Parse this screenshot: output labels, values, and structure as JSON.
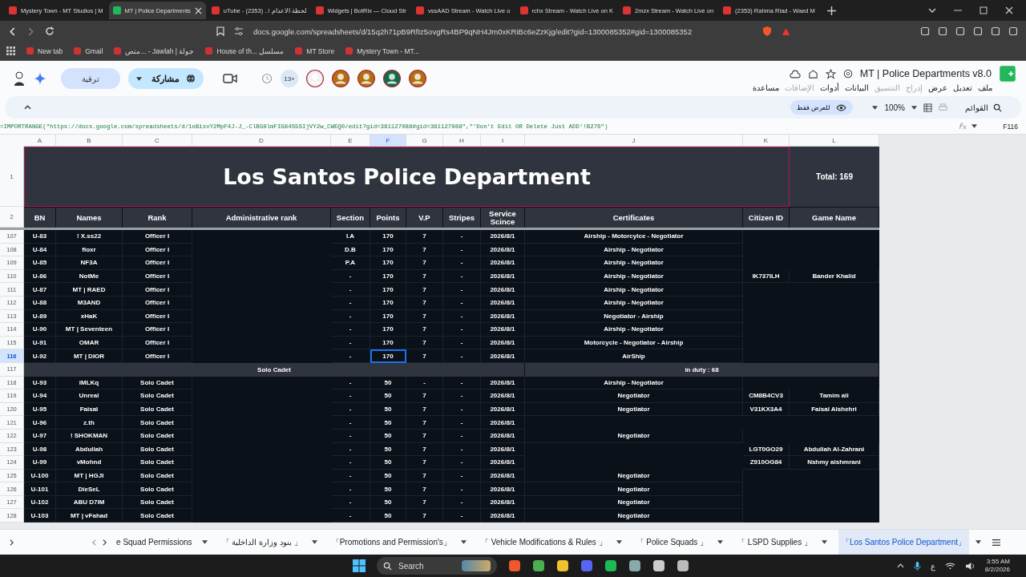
{
  "browser": {
    "tabs": [
      {
        "title": "Mystery Town - MT Studios | M",
        "selected": false
      },
      {
        "title": "MT | Police Departments",
        "selected": true
      },
      {
        "title": "uTube - لحظة الاعدام !.. (2353)",
        "selected": false
      },
      {
        "title": "Widgets | BotRix — Cloud Str",
        "selected": false
      },
      {
        "title": "vssAAD Stream - Watch Live o",
        "selected": false
      },
      {
        "title": "rchx Stream - Watch Live on K",
        "selected": false
      },
      {
        "title": "2mzx Stream - Watch Live on",
        "selected": false
      },
      {
        "title": "(2353) Rahma Riad - Waed M",
        "selected": false
      }
    ],
    "address": "docs.google.com/spreadsheets/d/15q2h71pB9RfIz5ovgRs4BP9qNH4Jm0xKRiBc6eZzKjg/edit?gid=1300085352#gid=1300085352",
    "bookmarks": [
      "New tab",
      "Gmail",
      "منص... - Jawlah | جولة",
      "House of th... مسلسل",
      "MT Store",
      "Mystery Town - MT..."
    ]
  },
  "sheets": {
    "title": "MT | Police Departments v8.0",
    "menus": [
      {
        "label": "ملف",
        "disabled": false
      },
      {
        "label": "تعديل",
        "disabled": false
      },
      {
        "label": "عرض",
        "disabled": false
      },
      {
        "label": "إدراج",
        "disabled": true
      },
      {
        "label": "التنسيق",
        "disabled": true
      },
      {
        "label": "البيانات",
        "disabled": false
      },
      {
        "label": "أدوات",
        "disabled": false
      },
      {
        "label": "الإضافات",
        "disabled": true
      },
      {
        "label": "مساعدة",
        "disabled": false
      }
    ],
    "share": "مشاركة",
    "upgrade": "ترقية",
    "badge": "13+",
    "search": "القوائم",
    "zoom": "100%",
    "view_only": "للعرض فقط",
    "formula": "=IMPORTRANGE(\"https://docs.google.com/spreadsheets/d/1oBisvY2MpF4J-J_-ClBG0lmFIG84S5SIjVY2w_CWEQ0/edit?gid=381127088#gid=381127088\",\"'Don't Edit OR Delete Just ADD'!B276\")",
    "cell_ref": "F116"
  },
  "columns": [
    {
      "letter": "A",
      "selected": false
    },
    {
      "letter": "B",
      "selected": false
    },
    {
      "letter": "C",
      "selected": false
    },
    {
      "letter": "D",
      "selected": false
    },
    {
      "letter": "E",
      "selected": false
    },
    {
      "letter": "F",
      "selected": true
    },
    {
      "letter": "G",
      "selected": false
    },
    {
      "letter": "H",
      "selected": false
    },
    {
      "letter": "I",
      "selected": false
    },
    {
      "letter": "J",
      "selected": false
    },
    {
      "letter": "K",
      "selected": false
    },
    {
      "letter": "L",
      "selected": false
    }
  ],
  "title_row": {
    "number": "1",
    "title": "Los Santos Police Department",
    "total": "Total: 169"
  },
  "header_row": {
    "number": "2",
    "cells": {
      "A": "BN",
      "B": "Names",
      "C": "Rank",
      "D": "Administrative rank",
      "E": "Section",
      "F": "Points",
      "G": "V.P",
      "H": "Stripes",
      "I": "Service Scince",
      "J": "Certificates",
      "K": "Citizen ID",
      "L": "Game Name"
    }
  },
  "rows": [
    {
      "kind": "data",
      "number": "107",
      "selected": false,
      "cells": {
        "A": "U-83",
        "B": "! X.ss22",
        "C": "Officer I",
        "E": "I.A",
        "F": "170",
        "G": "7",
        "H": "-",
        "I": "2026/8/1",
        "J": "Airship - Motorcylce - Negotiator"
      }
    },
    {
      "kind": "data",
      "number": "108",
      "selected": false,
      "cells": {
        "A": "U-84",
        "B": "floxr",
        "C": "Officer I",
        "E": "D.B",
        "F": "170",
        "G": "7",
        "H": "-",
        "I": "2026/8/1",
        "J": "Airship -  Negotiator"
      }
    },
    {
      "kind": "data",
      "number": "109",
      "selected": false,
      "cells": {
        "A": "U-85",
        "B": "NF3A",
        "C": "Officer I",
        "E": "P.A",
        "F": "170",
        "G": "7",
        "H": "-",
        "I": "2026/8/1",
        "J": "Airship - Negotiator"
      }
    },
    {
      "kind": "data",
      "number": "110",
      "selected": false,
      "cells": {
        "A": "U-86",
        "B": "NotMe",
        "C": "Officer I",
        "E": "-",
        "F": "170",
        "G": "7",
        "H": "-",
        "I": "2026/8/1",
        "J": "Airship - Negotiator",
        "K": "IK737ILH",
        "L": "Bander Khalid"
      }
    },
    {
      "kind": "data",
      "number": "111",
      "selected": false,
      "cells": {
        "A": "U-87",
        "B": "MT | RAED",
        "C": "Officer I",
        "E": "-",
        "F": "170",
        "G": "7",
        "H": "-",
        "I": "2026/8/1",
        "J": "Airship - Negotiator"
      }
    },
    {
      "kind": "data",
      "number": "112",
      "selected": false,
      "cells": {
        "A": "U-88",
        "B": "M3AND",
        "C": "Officer I",
        "E": "-",
        "F": "170",
        "G": "7",
        "H": "-",
        "I": "2026/8/1",
        "J": "Airship - Negotiator"
      }
    },
    {
      "kind": "data",
      "number": "113",
      "selected": false,
      "cells": {
        "A": "U-89",
        "B": "xHaK",
        "C": "Officer I",
        "E": "-",
        "F": "170",
        "G": "7",
        "H": "-",
        "I": "2026/8/1",
        "J": "Negotiator - Airship"
      }
    },
    {
      "kind": "data",
      "number": "114",
      "selected": false,
      "cells": {
        "A": "U-90",
        "B": "MT | Seventeen",
        "C": "Officer I",
        "E": "-",
        "F": "170",
        "G": "7",
        "H": "-",
        "I": "2026/8/1",
        "J": "Airship - Negotiator"
      }
    },
    {
      "kind": "data",
      "number": "115",
      "selected": false,
      "cells": {
        "A": "U-91",
        "B": "OMAR",
        "C": "Officer I",
        "E": "-",
        "F": "170",
        "G": "7",
        "H": "-",
        "I": "2026/8/1",
        "J": "Motorcycle - Negotiator - Airship"
      }
    },
    {
      "kind": "data",
      "number": "116",
      "selected": true,
      "cells": {
        "A": "U-92",
        "B": "MT | DIOR",
        "C": "Officer I",
        "E": "-",
        "F": "170",
        "G": "7",
        "H": "-",
        "I": "2026/8/1",
        "J": "AirShip"
      }
    },
    {
      "kind": "section",
      "number": "117",
      "selected": false,
      "label": "Solo Cadet",
      "note": "in duty : 68"
    },
    {
      "kind": "data",
      "number": "118",
      "selected": false,
      "cells": {
        "A": "U-93",
        "B": "iMLKq",
        "C": "Solo Cadet",
        "E": "-",
        "F": "50",
        "G": "-",
        "H": "-",
        "I": "2026/8/1",
        "J": "Airship - Negotiator"
      }
    },
    {
      "kind": "data",
      "number": "119",
      "selected": false,
      "cells": {
        "A": "U-94",
        "B": "Unreal",
        "C": "Solo Cadet",
        "E": "-",
        "F": "50",
        "G": "7",
        "H": "-",
        "I": "2026/8/1",
        "J": "Negotiator",
        "K": "CM8B4CV3",
        "L": "Tamim ali"
      }
    },
    {
      "kind": "data",
      "number": "120",
      "selected": false,
      "cells": {
        "A": "U-95",
        "B": "Faisal",
        "C": "Solo Cadet",
        "E": "-",
        "F": "50",
        "G": "7",
        "H": "-",
        "I": "2026/8/1",
        "J": "Negotiator",
        "K": "V31KX3A4",
        "L": "Faisal Alshehri"
      }
    },
    {
      "kind": "data",
      "number": "121",
      "selected": false,
      "cells": {
        "A": "U-96",
        "B": "z.th",
        "C": "Solo Cadet",
        "E": "-",
        "F": "50",
        "G": "7",
        "H": "-",
        "I": "2026/8/1"
      }
    },
    {
      "kind": "data",
      "number": "122",
      "selected": false,
      "cells": {
        "A": "U-97",
        "B": "! SHOKMAN",
        "C": "Solo Cadet",
        "E": "-",
        "F": "50",
        "G": "7",
        "H": "-",
        "I": "2026/8/1",
        "J": "Negotiator"
      }
    },
    {
      "kind": "data",
      "number": "123",
      "selected": false,
      "cells": {
        "A": "U-98",
        "B": "Abdullah",
        "C": "Solo Cadet",
        "E": "-",
        "F": "50",
        "G": "7",
        "H": "-",
        "I": "2026/8/1",
        "K": "LGT0GO29",
        "L": "Abdullah Al-Zahrani"
      }
    },
    {
      "kind": "data",
      "number": "124",
      "selected": false,
      "cells": {
        "A": "U-99",
        "B": "vMohnd",
        "C": "Solo Cadet",
        "E": "-",
        "F": "50",
        "G": "7",
        "H": "-",
        "I": "2026/8/1",
        "K": "Z910OG84",
        "L": "Nshmy alshmrani"
      }
    },
    {
      "kind": "data",
      "number": "125",
      "selected": false,
      "cells": {
        "A": "U-100",
        "B": "MT | HGJI",
        "C": "Solo Cadet",
        "E": "-",
        "F": "50",
        "G": "7",
        "H": "-",
        "I": "2026/8/1",
        "J": "Negotiator"
      }
    },
    {
      "kind": "data",
      "number": "126",
      "selected": false,
      "cells": {
        "A": "U-101",
        "B": "DieSeL",
        "C": "Solo Cadet",
        "E": "-",
        "F": "50",
        "G": "7",
        "H": "-",
        "I": "2026/8/1",
        "J": "Negotiator"
      }
    },
    {
      "kind": "data",
      "number": "127",
      "selected": false,
      "cells": {
        "A": "U-102",
        "B": "ABU D7IM",
        "C": "Solo Cadet",
        "E": "-",
        "F": "50",
        "G": "7",
        "H": "-",
        "I": "2026/8/1",
        "J": "Negotiator"
      }
    },
    {
      "kind": "data",
      "number": "128",
      "selected": false,
      "cells": {
        "A": "U-103",
        "B": "MT | vFahad",
        "C": "Solo Cadet",
        "E": "-",
        "F": "50",
        "G": "7",
        "H": "-",
        "I": "2026/8/1",
        "J": "Negotiator"
      }
    }
  ],
  "sheet_tabs": [
    {
      "label": "e Squad Permissions",
      "selected": false
    },
    {
      "label": "「 بنود وزارة الداخلية 」",
      "selected": false
    },
    {
      "label": "「Promotions and Permission's」",
      "selected": false
    },
    {
      "label": "「 Vehicle Modifications & Rules 」",
      "selected": false
    },
    {
      "label": "「 Police Squads 」",
      "selected": false
    },
    {
      "label": "「 LSPD Supplies 」",
      "selected": false
    },
    {
      "label": "「Los Santos Police Department」",
      "selected": true
    }
  ],
  "taskbar": {
    "search": "Search",
    "language": "ع",
    "time": "3:55 AM",
    "date": "8/2/2026"
  }
}
